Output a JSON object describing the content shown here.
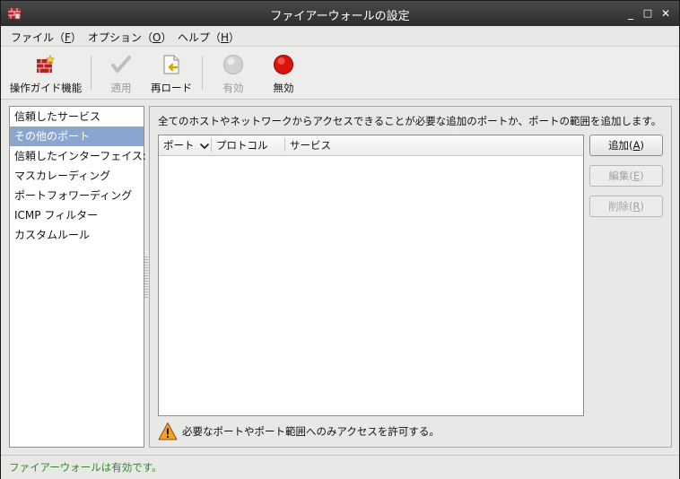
{
  "window": {
    "title": "ファイアーウォールの設定",
    "minimize_glyph": "_",
    "maximize_glyph": "□",
    "close_glyph": "✕"
  },
  "menu": {
    "file": {
      "text": "ファイル（",
      "key": "F",
      "end": "）"
    },
    "options": {
      "text": "オプション（",
      "key": "O",
      "end": "）"
    },
    "help": {
      "text": "ヘルプ（",
      "key": "H",
      "end": "）"
    }
  },
  "toolbar": {
    "wizard": "操作ガイド機能",
    "apply": "適用",
    "reload": "再ロード",
    "enable": "有効",
    "disable": "無効"
  },
  "sidebar": {
    "items": [
      "信頼したサービス",
      "その他のポート",
      "信頼したインターフェイス:",
      "マスカレーディング",
      "ポートフォワーディング",
      "ICMP フィルター",
      "カスタムルール"
    ],
    "selected_index": 1
  },
  "panel": {
    "description": "全てのホストやネットワークからアクセスできることが必要な追加のポートか、ポートの範囲を追加します。",
    "columns": {
      "port": "ポート",
      "protocol": "プロトコル",
      "service": "サービス"
    },
    "rows": [],
    "buttons": {
      "add": {
        "text": "追加(",
        "key": "A",
        "end": ")"
      },
      "edit": {
        "text": "編集(",
        "key": "E",
        "end": ")"
      },
      "delete": {
        "text": "削除(",
        "key": "R",
        "end": ")"
      }
    },
    "warning": "必要なポートやポート範囲へのみアクセスを許可する。"
  },
  "status": {
    "text": "ファイアーウォールは有効です。",
    "color": "#2a8a2a"
  },
  "icons": {
    "app": "firewall-icon",
    "wizard": "firewall-wizard-icon",
    "apply": "checkmark-icon",
    "reload": "reload-icon",
    "enable": "green-circle-icon",
    "disable": "red-circle-icon",
    "warning": "warning-icon",
    "sort": "chevron-down-icon"
  }
}
